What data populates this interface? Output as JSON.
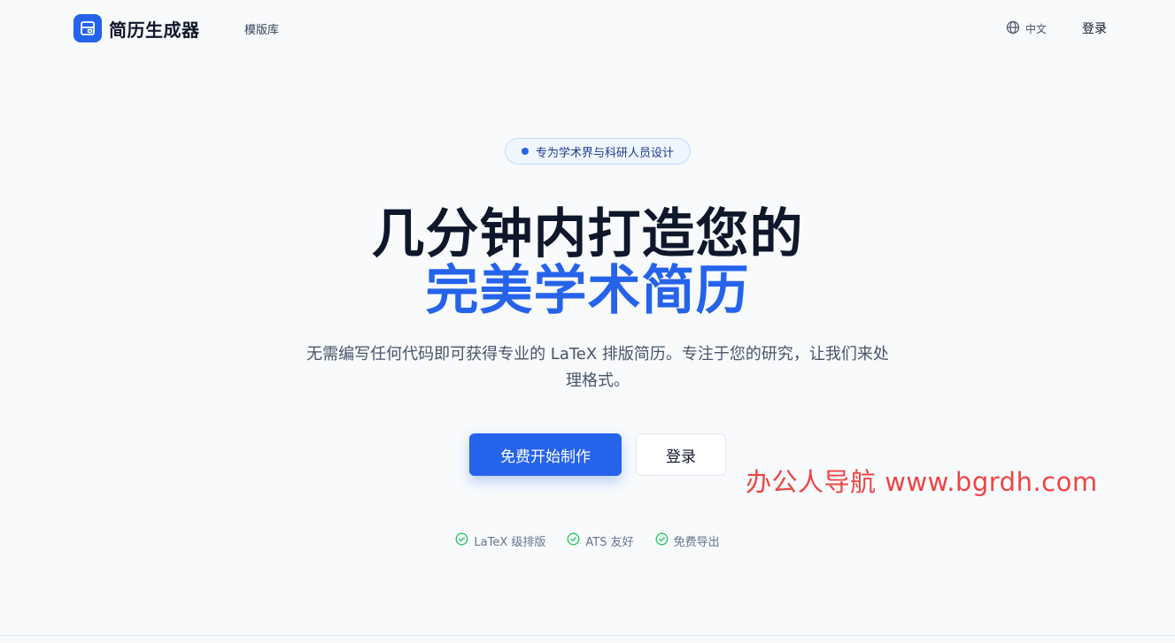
{
  "header": {
    "brand": "简历生成器",
    "nav_templates": "模版库",
    "language": "中文",
    "login": "登录"
  },
  "hero": {
    "badge": "专为学术界与科研人员设计",
    "title_line1": "几分钟内打造您的",
    "title_line2": "完美学术简历",
    "subtitle": "无需编写任何代码即可获得专业的 LaTeX 排版简历。专注于您的研究，让我们来处理格式。",
    "cta_primary": "免费开始制作",
    "cta_secondary": "登录"
  },
  "features": [
    {
      "label": "LaTeX 级排版",
      "icon": "check-circle-icon"
    },
    {
      "label": "ATS 友好",
      "icon": "check-circle-icon"
    },
    {
      "label": "免费导出",
      "icon": "check-circle-icon"
    }
  ],
  "watermark": "办公人导航  www.bgrdh.com",
  "colors": {
    "accent": "#2563eb",
    "text": "#0f172a",
    "muted": "#475569",
    "success": "#22c55e",
    "watermark": "#ef4444"
  }
}
